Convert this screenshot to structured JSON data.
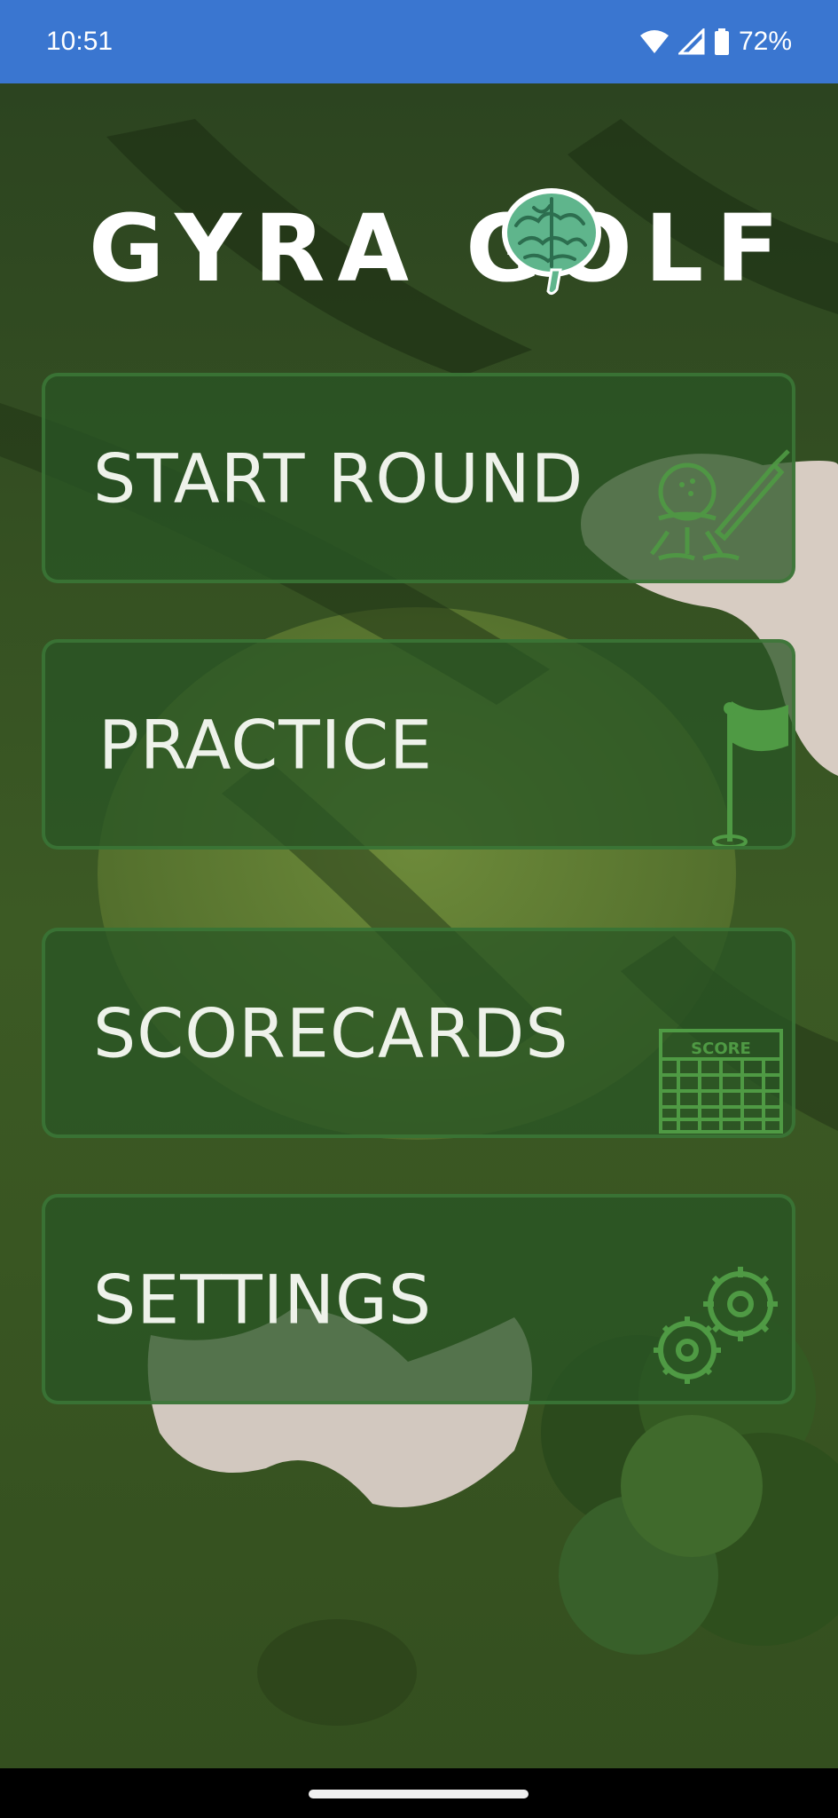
{
  "status_bar": {
    "time": "10:51",
    "battery_percent": "72%",
    "icons": [
      "wifi-icon",
      "cellular-signal-icon",
      "battery-icon"
    ]
  },
  "logo": {
    "text": "GYRA GOLF",
    "brain_color": "#5fb58c"
  },
  "menu": {
    "items": [
      {
        "label": "START ROUND",
        "icon": "golfer-swing-icon"
      },
      {
        "label": "PRACTICE",
        "icon": "golf-flag-icon"
      },
      {
        "label": "SCORECARDS",
        "icon": "scorecard-icon",
        "icon_text": "SCORE"
      },
      {
        "label": "SETTINGS",
        "icon": "gears-icon"
      }
    ]
  },
  "colors": {
    "status_bar": "#3a76d0",
    "button_fill": "#28552499",
    "button_border": "#3c7837",
    "grass_dark": "#2f4a1f",
    "sand": "#d7ccc2"
  }
}
